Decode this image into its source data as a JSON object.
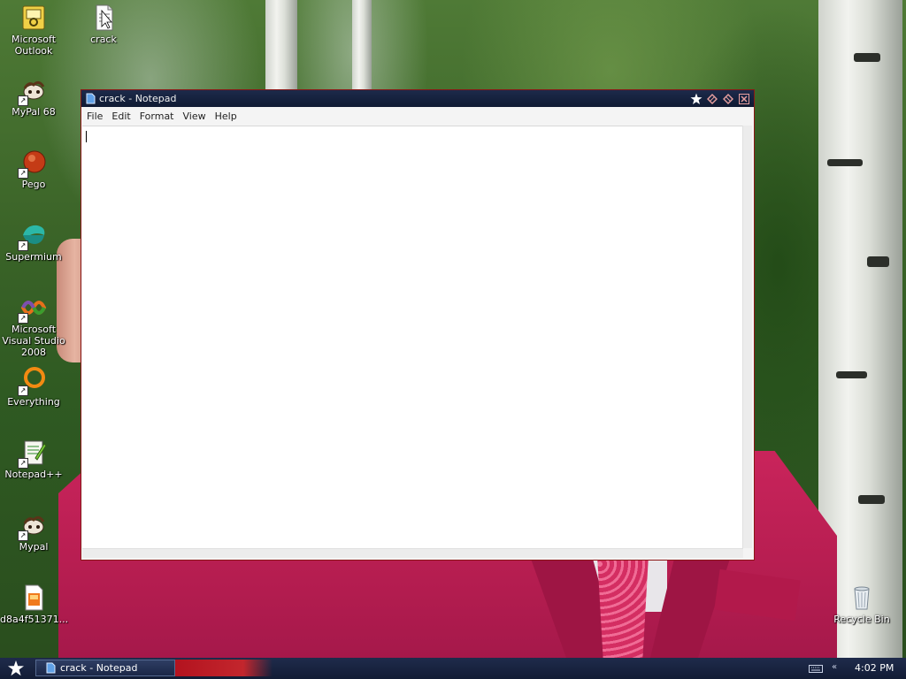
{
  "desktop": {
    "icons": [
      {
        "label": "Microsoft Outlook",
        "icon": "outlook-icon",
        "shortcut": false
      },
      {
        "label": "crack",
        "icon": "text-file-icon",
        "shortcut": false
      },
      {
        "label": "MyPal 68",
        "icon": "mypal-icon",
        "shortcut": true
      },
      {
        "label": "Pego",
        "icon": "pego-icon",
        "shortcut": true
      },
      {
        "label": "Supermium",
        "icon": "supermium-icon",
        "shortcut": true
      },
      {
        "label": "Microsoft Visual Studio 2008",
        "icon": "visual-studio-icon",
        "shortcut": true
      },
      {
        "label": "Everything",
        "icon": "everything-icon",
        "shortcut": true
      },
      {
        "label": "Notepad++",
        "icon": "notepadpp-icon",
        "shortcut": true
      },
      {
        "label": "Mypal",
        "icon": "mypal-icon",
        "shortcut": true
      },
      {
        "label": "d8a4f51371...",
        "icon": "image-file-icon",
        "shortcut": false
      },
      {
        "label": "Recycle Bin",
        "icon": "recycle-bin-icon",
        "shortcut": false
      }
    ]
  },
  "window": {
    "title": "crack - Notepad",
    "menu": [
      "File",
      "Edit",
      "Format",
      "View",
      "Help"
    ],
    "content": "",
    "accent_color": "#8b1616"
  },
  "taskbar": {
    "task_label": "crack - Notepad",
    "clock": "4:02 PM",
    "tray_arrow": "«"
  }
}
